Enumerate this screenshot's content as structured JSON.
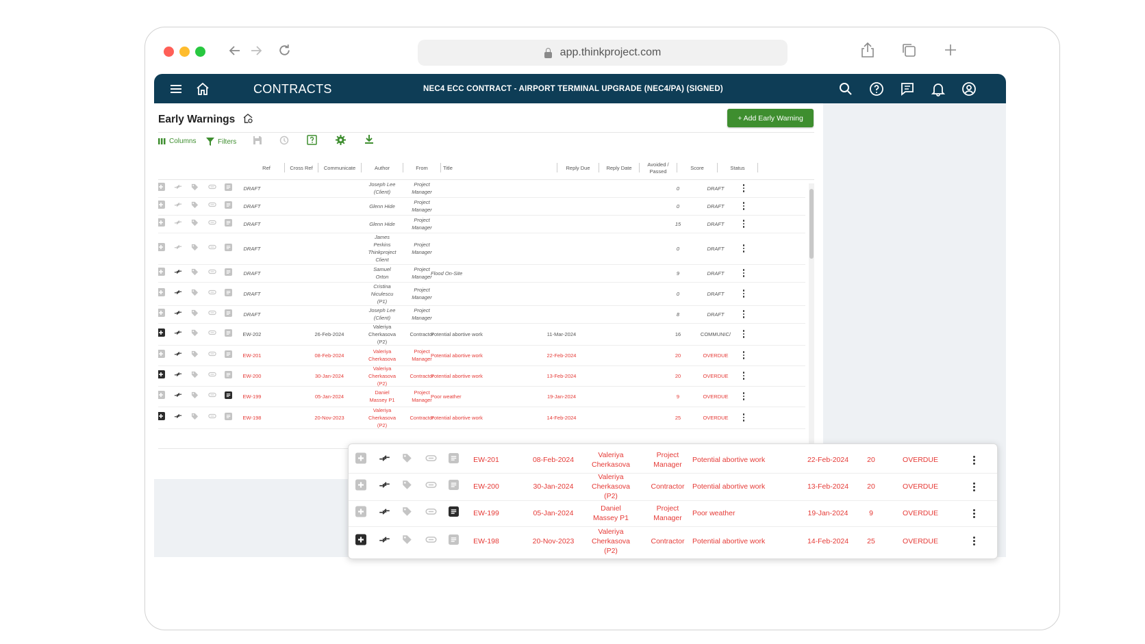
{
  "browser": {
    "url": "app.thinkproject.com",
    "traffic_lights": [
      "#ff5f57",
      "#febc2e",
      "#28c840"
    ]
  },
  "appbar": {
    "module": "CONTRACTS",
    "contract_title": "NEC4 ECC CONTRACT - AIRPORT TERMINAL UPGRADE (NEC4/PA) (SIGNED)",
    "background": "#0e3d56"
  },
  "page": {
    "title": "Early Warnings",
    "add_button": "+ Add Early Warning",
    "accent": "#3e8e2f",
    "overdue_color": "#e53935"
  },
  "toolbar": {
    "columns": "Columns",
    "filters": "Filters"
  },
  "columns": [
    "Ref",
    "Cross Ref",
    "Communicate",
    "Author",
    "From",
    "Title",
    "Reply Due",
    "Reply Date",
    "Avoided /\nPassed",
    "Score",
    "Status"
  ],
  "rows": [
    {
      "ref": "DRAFT",
      "comm": "",
      "author": "Joseph Lee\n(Client)",
      "from": "Project\nManager",
      "title": "",
      "due": "",
      "score": "0",
      "status": "DRAFT",
      "kind": "draft",
      "h": 26
    },
    {
      "ref": "DRAFT",
      "comm": "",
      "author": "Glenn Hide",
      "from": "Project\nManager",
      "title": "",
      "due": "",
      "score": "0",
      "status": "DRAFT",
      "kind": "draft",
      "h": 26
    },
    {
      "ref": "DRAFT",
      "comm": "",
      "author": "Glenn Hide",
      "from": "Project\nManager",
      "title": "",
      "due": "",
      "score": "15",
      "status": "DRAFT",
      "kind": "draft",
      "h": 26
    },
    {
      "ref": "DRAFT",
      "comm": "",
      "author": "James\nPerkins\nThinkproject\nClient",
      "from": "Project\nManager",
      "title": "",
      "due": "",
      "score": "0",
      "status": "DRAFT",
      "kind": "draft",
      "h": 46
    },
    {
      "ref": "DRAFT",
      "comm": "",
      "author": "Samuel\nOrton",
      "from": "Project\nManager",
      "title": "Flood On-Site",
      "due": "",
      "score": "9",
      "status": "DRAFT",
      "kind": "draft",
      "h": 26
    },
    {
      "ref": "DRAFT",
      "comm": "",
      "author": "Cristina\nNiculescu\n(P1)",
      "from": "Project\nManager",
      "title": "",
      "due": "",
      "score": "0",
      "status": "DRAFT",
      "kind": "draft",
      "h": 34
    },
    {
      "ref": "DRAFT",
      "comm": "",
      "author": "Joseph Lee\n(Client)",
      "from": "Project\nManager",
      "title": "",
      "due": "",
      "score": "8",
      "status": "DRAFT",
      "kind": "draft",
      "h": 26
    },
    {
      "ref": "EW-202",
      "comm": "26-Feb-2024",
      "author": "Valeriya\nCherkasova\n(P2)",
      "from": "Contractor",
      "title": "Potential abortive work",
      "due": "11-Mar-2024",
      "score": "16",
      "status": "COMMUNIC/",
      "kind": "normal",
      "h": 32
    },
    {
      "ref": "EW-201",
      "comm": "08-Feb-2024",
      "author": "Valeriya\nCherkasova",
      "from": "Project\nManager",
      "title": "Potential abortive work",
      "due": "22-Feb-2024",
      "score": "20",
      "status": "OVERDUE",
      "kind": "red",
      "h": 30
    },
    {
      "ref": "EW-200",
      "comm": "30-Jan-2024",
      "author": "Valeriya\nCherkasova\n(P2)",
      "from": "Contractor",
      "title": "Potential abortive work",
      "due": "13-Feb-2024",
      "score": "20",
      "status": "OVERDUE",
      "kind": "red",
      "h": 30
    },
    {
      "ref": "EW-199",
      "comm": "05-Jan-2024",
      "author": "Daniel\nMassey P1",
      "from": "Project\nManager",
      "title": "Poor weather",
      "due": "19-Jan-2024",
      "score": "9",
      "status": "OVERDUE",
      "kind": "red",
      "h": 30
    },
    {
      "ref": "EW-198",
      "comm": "20-Nov-2023",
      "author": "Valeriya\nCherkasova\n(P2)",
      "from": "Contractor",
      "title": "Potential abortive work",
      "due": "14-Feb-2024",
      "score": "25",
      "status": "OVERDUE",
      "kind": "red",
      "h": 32
    }
  ],
  "zoom_rows": [
    {
      "ref": "EW-201",
      "comm": "08-Feb-2024",
      "author": "Valeriya\nCherkasova",
      "from": "Project\nManager",
      "title": "Potential abortive work",
      "due": "22-Feb-2024",
      "score": "20",
      "status": "OVERDUE",
      "h": 38
    },
    {
      "ref": "EW-200",
      "comm": "30-Jan-2024",
      "author": "Valeriya\nCherkasova\n(P2)",
      "from": "Contractor",
      "title": "Potential abortive work",
      "due": "13-Feb-2024",
      "score": "20",
      "status": "OVERDUE",
      "h": 40
    },
    {
      "ref": "EW-199",
      "comm": "05-Jan-2024",
      "author": "Daniel\nMassey P1",
      "from": "Project\nManager",
      "title": "Poor weather",
      "due": "19-Jan-2024",
      "score": "9",
      "status": "OVERDUE",
      "h": 38
    },
    {
      "ref": "EW-198",
      "comm": "20-Nov-2023",
      "author": "Valeriya\nCherkasova\n(P2)",
      "from": "Contractor",
      "title": "Potential abortive work",
      "due": "14-Feb-2024",
      "score": "25",
      "status": "OVERDUE",
      "h": 43
    }
  ]
}
